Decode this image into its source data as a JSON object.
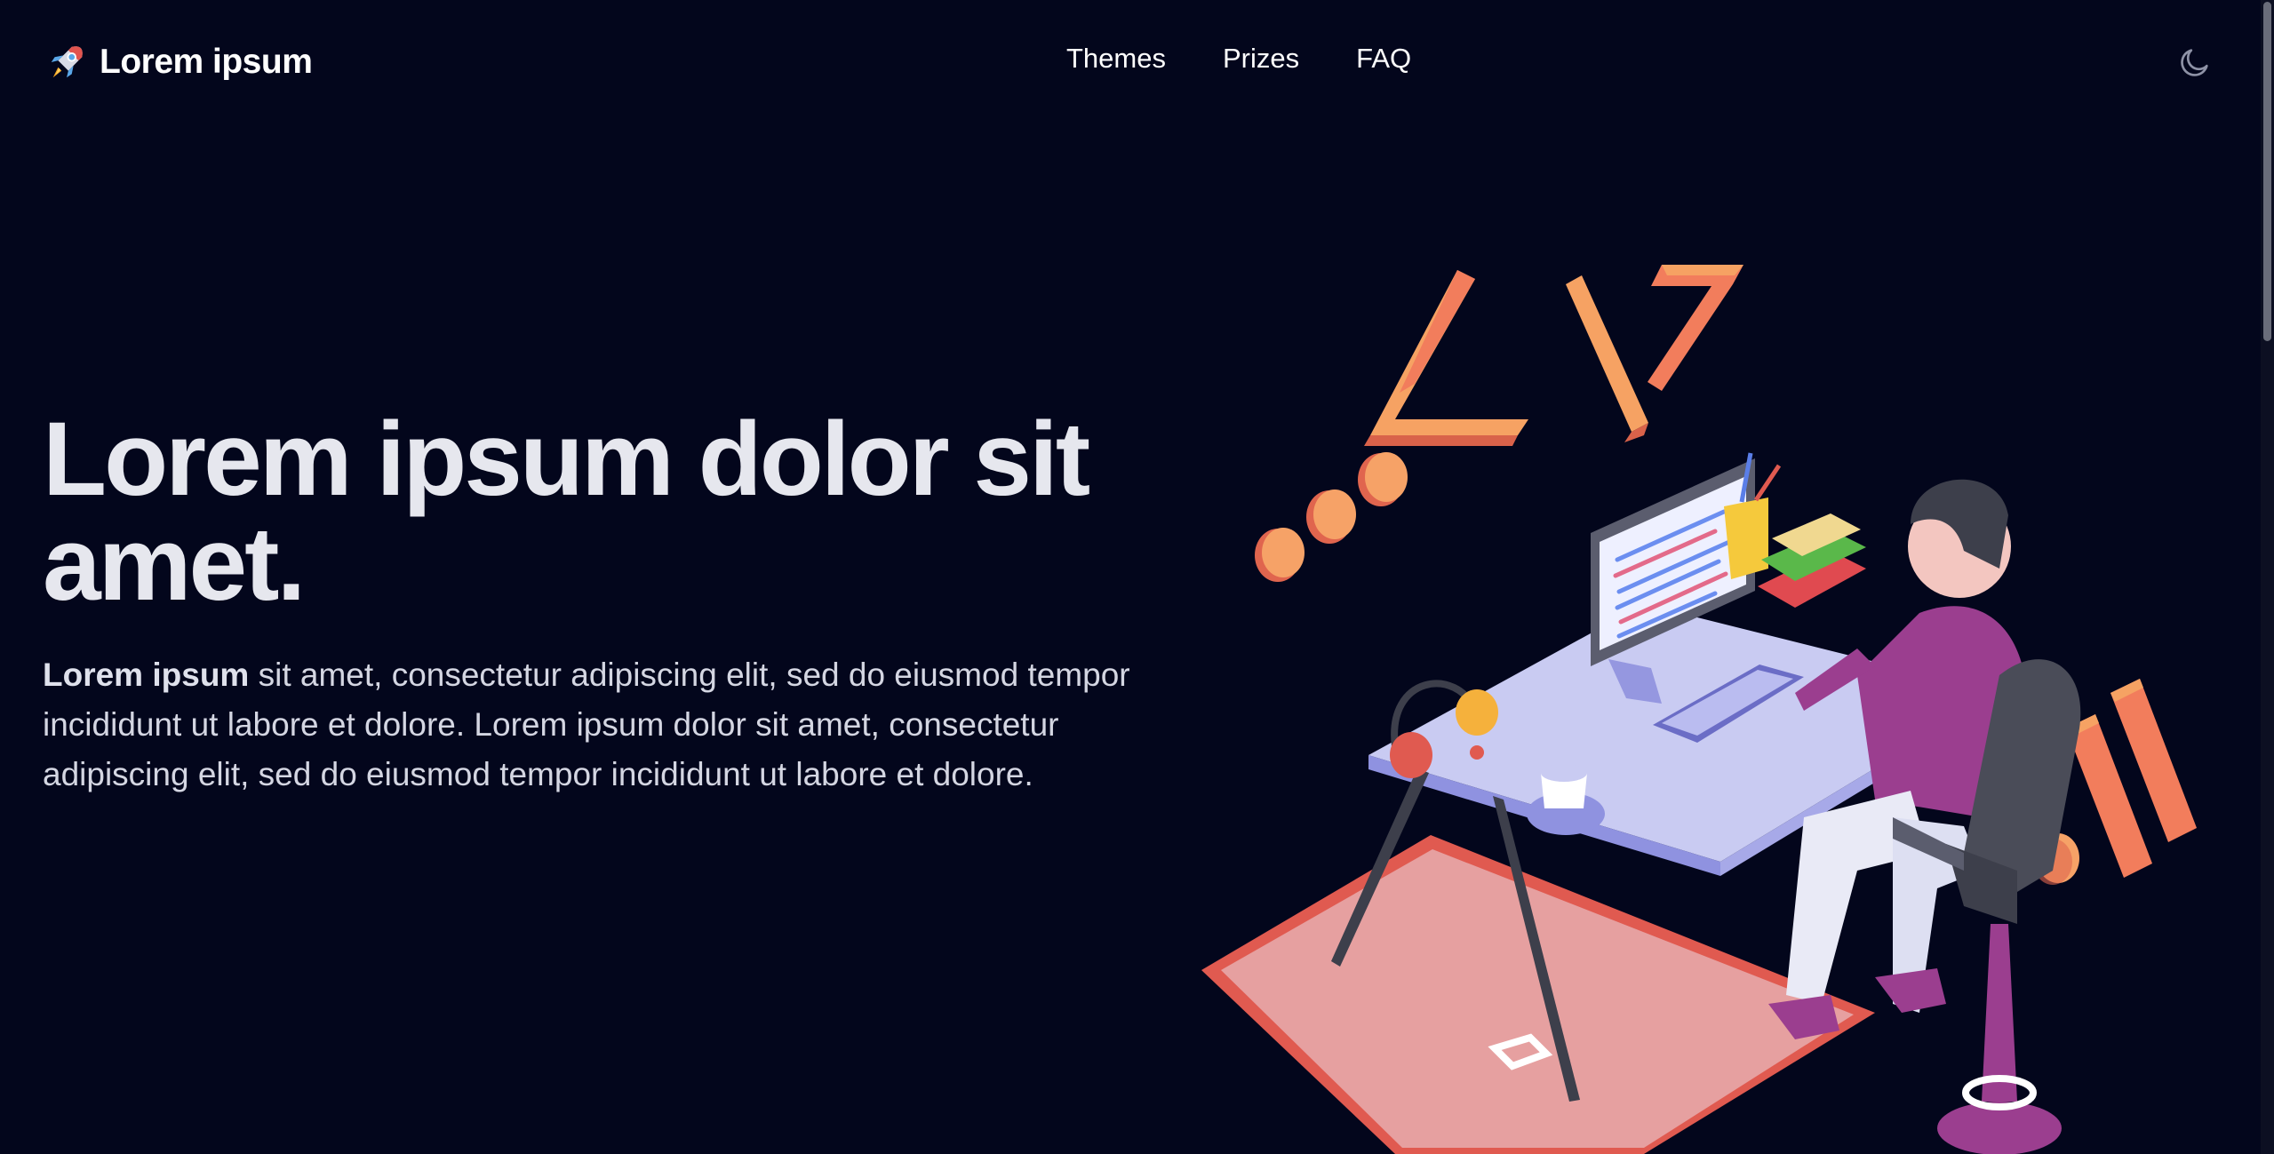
{
  "brand": {
    "name": "Lorem ipsum",
    "icon": "rocket-icon"
  },
  "nav": {
    "items": [
      {
        "label": "Themes"
      },
      {
        "label": "Prizes"
      },
      {
        "label": "FAQ"
      }
    ],
    "theme_toggle_icon": "moon-icon"
  },
  "hero": {
    "title": "Lorem ipsum dolor sit amet.",
    "description_bold": "Lorem ipsum",
    "description_rest": " sit amet, consectetur adipiscing elit, sed do eiusmod tempor incididunt ut labore et dolore. Lorem ipsum dolor sit amet, consectetur adipiscing elit, sed do eiusmod tempor incididunt ut labore et dolore.",
    "illustration": "developer-at-desk-illustration"
  },
  "colors": {
    "background": "#03061c",
    "accent_orange": "#f27d5c",
    "accent_purple": "#9b3e8f"
  }
}
